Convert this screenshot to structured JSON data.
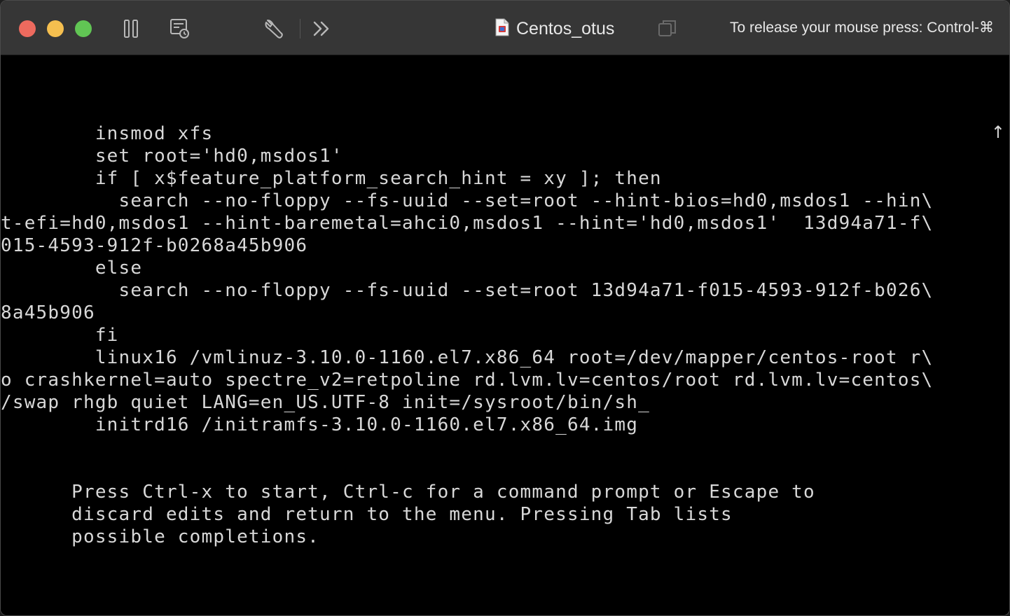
{
  "window": {
    "title": "Centos_otus",
    "release_hint": "To release your mouse press: Control-⌘"
  },
  "toolbar": {
    "icons": [
      "pause-icon",
      "snapshot-icon",
      "settings-wrench-icon",
      "more-chevrons-icon",
      "document-icon",
      "copy-window-icon"
    ]
  },
  "console": {
    "scroll_indicator": "↑",
    "lines": [
      "        insmod xfs",
      "        set root='hd0,msdos1'",
      "        if [ x$feature_platform_search_hint = xy ]; then",
      "          search --no-floppy --fs-uuid --set=root --hint-bios=hd0,msdos1 --hin\\",
      "t-efi=hd0,msdos1 --hint-baremetal=ahci0,msdos1 --hint='hd0,msdos1'  13d94a71-f\\",
      "015-4593-912f-b0268a45b906",
      "        else",
      "          search --no-floppy --fs-uuid --set=root 13d94a71-f015-4593-912f-b026\\",
      "8a45b906",
      "        fi",
      "        linux16 /vmlinuz-3.10.0-1160.el7.x86_64 root=/dev/mapper/centos-root r\\",
      "o crashkernel=auto spectre_v2=retpoline rd.lvm.lv=centos/root rd.lvm.lv=centos\\",
      "/swap rhgb quiet LANG=en_US.UTF-8 init=/sysroot/bin/sh_",
      "        initrd16 /initramfs-3.10.0-1160.el7.x86_64.img"
    ],
    "help_lines": [
      "      Press Ctrl-x to start, Ctrl-c for a command prompt or Escape to",
      "      discard edits and return to the menu. Pressing Tab lists",
      "      possible completions."
    ]
  }
}
